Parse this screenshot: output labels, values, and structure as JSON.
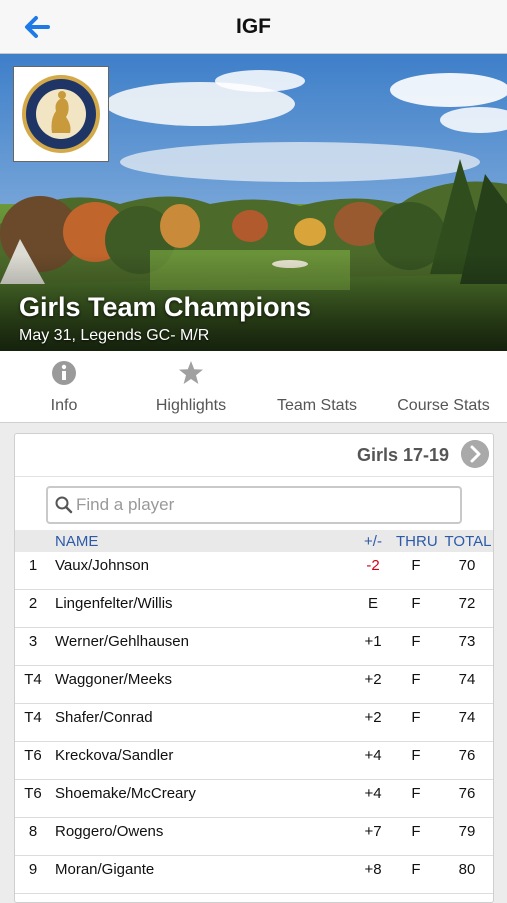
{
  "nav": {
    "title": "IGF"
  },
  "event": {
    "title": "Girls Team Champions",
    "subtitle": "May 31, Legends GC- M/R"
  },
  "tabs": [
    {
      "label": "Info",
      "icon": "info-icon"
    },
    {
      "label": "Highlights",
      "icon": "star-icon"
    },
    {
      "label": "Team Stats"
    },
    {
      "label": "Course Stats"
    }
  ],
  "leaderboard": {
    "division": "Girls 17-19",
    "search_placeholder": "Find a player",
    "headers": {
      "name": "NAME",
      "score": "+/-",
      "thru": "THRU",
      "total": "TOTAL"
    },
    "rows": [
      {
        "pos": "1",
        "name": "Vaux/Johnson",
        "score": "-2",
        "thru": "F",
        "total": "70"
      },
      {
        "pos": "2",
        "name": "Lingenfelter/Willis",
        "score": "E",
        "thru": "F",
        "total": "72"
      },
      {
        "pos": "3",
        "name": "Werner/Gehlhausen",
        "score": "+1",
        "thru": "F",
        "total": "73"
      },
      {
        "pos": "T4",
        "name": "Waggoner/Meeks",
        "score": "+2",
        "thru": "F",
        "total": "74"
      },
      {
        "pos": "T4",
        "name": "Shafer/Conrad",
        "score": "+2",
        "thru": "F",
        "total": "74"
      },
      {
        "pos": "T6",
        "name": "Kreckova/Sandler",
        "score": "+4",
        "thru": "F",
        "total": "76"
      },
      {
        "pos": "T6",
        "name": "Shoemake/McCreary",
        "score": "+4",
        "thru": "F",
        "total": "76"
      },
      {
        "pos": "8",
        "name": "Roggero/Owens",
        "score": "+7",
        "thru": "F",
        "total": "79"
      },
      {
        "pos": "9",
        "name": "Moran/Gigante",
        "score": "+8",
        "thru": "F",
        "total": "80"
      }
    ]
  },
  "colors": {
    "accent": "#1e7be6",
    "header_text": "#2c5aa8",
    "under_par": "#d0021b"
  }
}
